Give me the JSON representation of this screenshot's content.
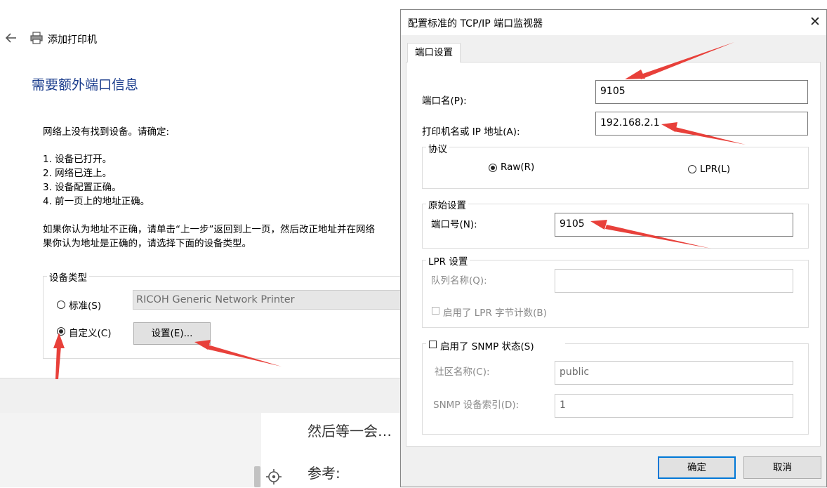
{
  "background_document": {
    "text_1": "然后等一会…",
    "text_2": "参考:"
  },
  "wizard": {
    "title": "添加打印机",
    "heading": "需要额外端口信息",
    "intro": "网络上没有找到设备。请确定:",
    "checklist": [
      "1.  设备已打开。",
      "2.  网络已连上。",
      "3.  设备配置正确。",
      "4.  前一页上的地址正确。"
    ],
    "note_line1": "如果你认为地址不正确，请单击“上一步”返回到上一页，然后改正地址并在网络",
    "note_line2": "果你认为地址是正确的，请选择下面的设备类型。",
    "device_type": {
      "legend": "设备类型",
      "standard_label": "标准(S)",
      "standard_selected": false,
      "standard_value": "RICOH Generic Network Printer",
      "custom_label": "自定义(C)",
      "custom_selected": true,
      "settings_button": "设置(E)..."
    }
  },
  "dialog": {
    "title": "配置标准的 TCP/IP 端口监视器",
    "close_glyph": "✕",
    "tab": "端口设置",
    "port_name_label": "端口名(P):",
    "port_name_value": "9105",
    "host_label": "打印机名或 IP 地址(A):",
    "host_value": "192.168.2.1",
    "protocol": {
      "legend": "协议",
      "raw_label": "Raw(R)",
      "raw_selected": true,
      "lpr_label": "LPR(L)",
      "lpr_selected": false
    },
    "raw_settings": {
      "legend": "原始设置",
      "port_number_label": "端口号(N):",
      "port_number_value": "9105"
    },
    "lpr_settings": {
      "legend": "LPR 设置",
      "queue_name_label": "队列名称(Q):",
      "queue_name_value": "",
      "byte_count_label": "启用了 LPR 字节计数(B)",
      "byte_count_checked": false
    },
    "snmp": {
      "legend": "启用了 SNMP 状态(S)",
      "checked": false,
      "community_label": "社区名称(C):",
      "community_value": "public",
      "device_index_label": "SNMP 设备索引(D):",
      "device_index_value": "1"
    },
    "ok_button": "确定",
    "cancel_button": "取消"
  },
  "colors": {
    "heading_blue": "#1a3c8c",
    "default_button_border": "#0078d7",
    "annotation_red": "#e8403a"
  }
}
